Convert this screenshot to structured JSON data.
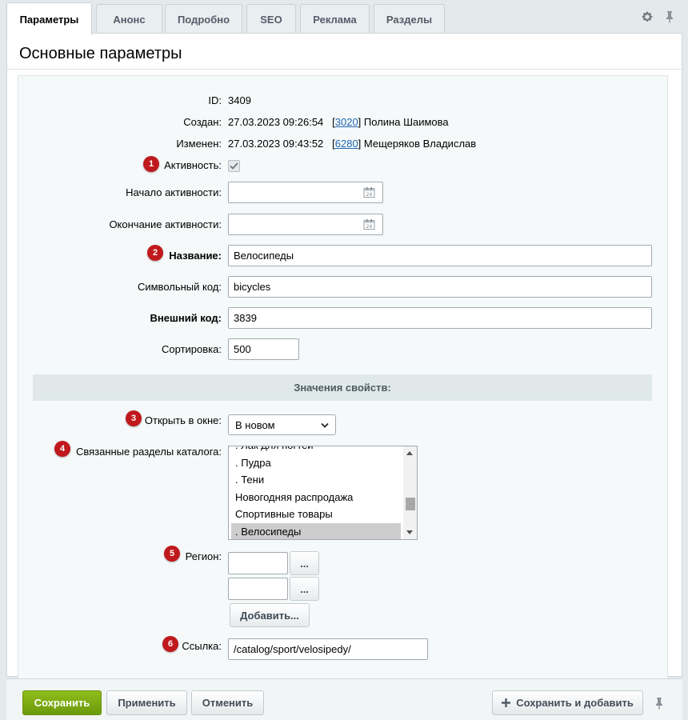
{
  "tabs": [
    {
      "label": "Параметры",
      "active": true
    },
    {
      "label": "Анонс"
    },
    {
      "label": "Подробно"
    },
    {
      "label": "SEO"
    },
    {
      "label": "Реклама"
    },
    {
      "label": "Разделы"
    }
  ],
  "panel_title": "Основные параметры",
  "fields": {
    "id": {
      "label": "ID:",
      "value": "3409"
    },
    "created": {
      "label": "Создан:",
      "date": "27.03.2023 09:26:54",
      "bracket_open": "[",
      "user_id": "3020",
      "bracket_close": "]",
      "user_name": "Полина Шаимова"
    },
    "modified": {
      "label": "Изменен:",
      "date": "27.03.2023 09:43:52",
      "bracket_open": "[",
      "user_id": "6280",
      "bracket_close": "]",
      "user_name": "Мещеряков Владислав"
    },
    "active": {
      "label": "Активность:",
      "checked": true
    },
    "active_from": {
      "label": "Начало активности:",
      "value": ""
    },
    "active_to": {
      "label": "Окончание активности:",
      "value": ""
    },
    "name": {
      "label": "Название:",
      "value": "Велосипеды"
    },
    "code": {
      "label": "Символьный код:",
      "value": "bicycles"
    },
    "xml_id": {
      "label": "Внешний код:",
      "value": "3839"
    },
    "sort": {
      "label": "Сортировка:",
      "value": "500"
    }
  },
  "properties_section": "Значения свойств:",
  "properties": {
    "open_in_window": {
      "label": "Открыть в окне:",
      "value": "В новом"
    },
    "linked_sections": {
      "label": "Связанные разделы каталога:",
      "items": [
        ". Лак для ногтей",
        ". Пудра",
        ". Тени",
        "Новогодняя распродажа",
        "Спортивные товары",
        ". Велосипеды"
      ],
      "selected_index": 5
    },
    "region": {
      "label": "Регион:",
      "browse_label": "...",
      "add_label": "Добавить..."
    },
    "link": {
      "label": "Ссылка:",
      "value": "/catalog/sport/velosipedy/"
    }
  },
  "badges": [
    "1",
    "2",
    "3",
    "4",
    "5",
    "6"
  ],
  "footer": {
    "save": "Сохранить",
    "apply": "Применить",
    "cancel": "Отменить",
    "save_and_add": "Сохранить и добавить"
  },
  "colors": {
    "accent_green": "#7aab12",
    "badge_red": "#c0191d",
    "link_blue": "#2067b0"
  }
}
